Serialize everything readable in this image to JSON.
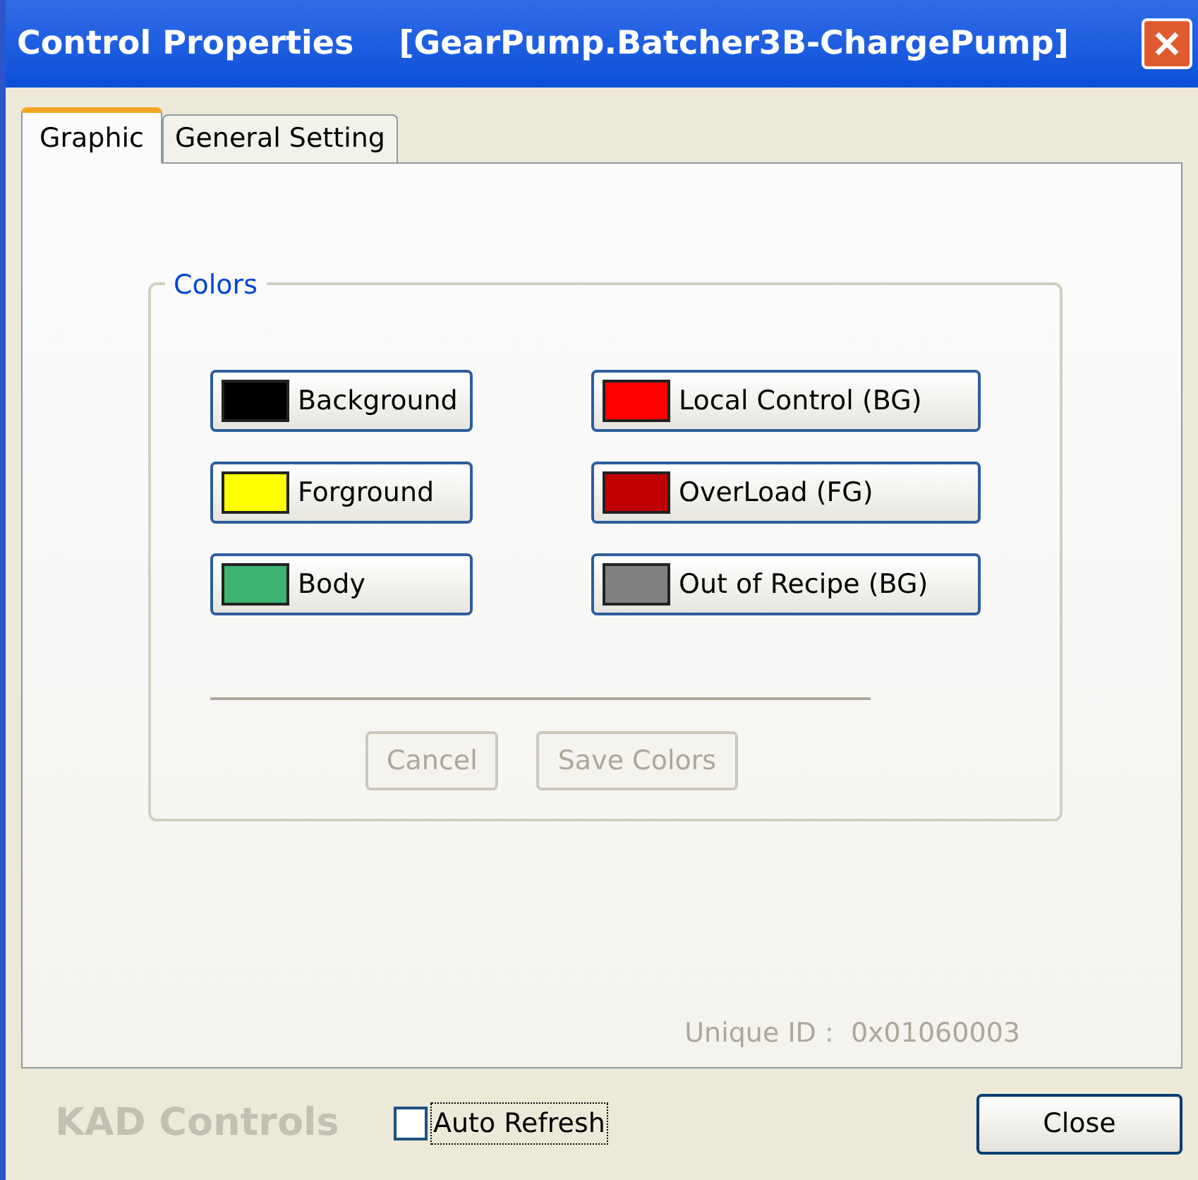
{
  "window": {
    "title": "Control Properties    [GearPump.Batcher3B-ChargePump]"
  },
  "tabs": [
    {
      "label": "Graphic",
      "selected": true
    },
    {
      "label": "General Setting",
      "selected": false
    }
  ],
  "colors_group": {
    "title": "Colors",
    "buttons": [
      {
        "label": "Background",
        "color": "#000000"
      },
      {
        "label": "Local Control (BG)",
        "color": "#ff0000"
      },
      {
        "label": "Forground",
        "color": "#ffff00"
      },
      {
        "label": "OverLoad (FG)",
        "color": "#c00000"
      },
      {
        "label": "Body",
        "color": "#3cb371"
      },
      {
        "label": "Out of Recipe (BG)",
        "color": "#808080"
      }
    ],
    "actions": [
      {
        "label": "Cancel",
        "disabled": true
      },
      {
        "label": "Save Colors",
        "disabled": true
      }
    ]
  },
  "unique_id": "Unique ID :  0x01060003",
  "footer": {
    "brand": "KAD Controls",
    "auto_refresh": {
      "label": "Auto Refresh",
      "checked": false
    },
    "close": "Close"
  }
}
